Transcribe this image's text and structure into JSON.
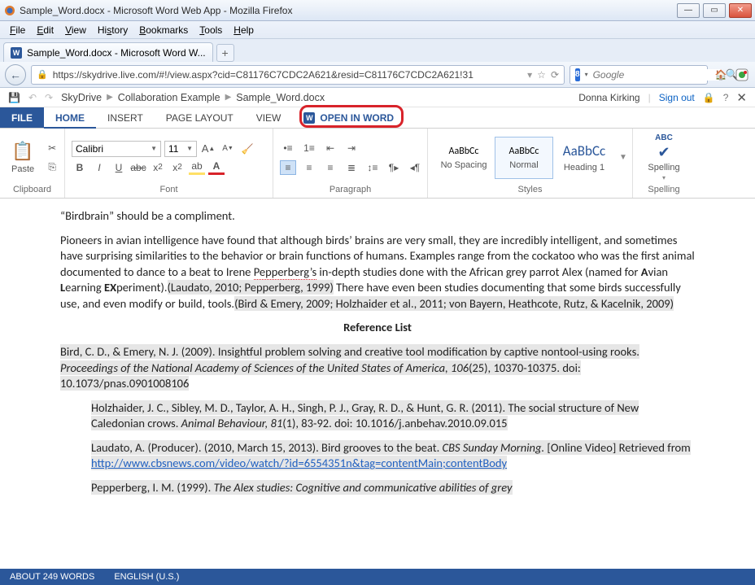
{
  "firefox": {
    "title": "Sample_Word.docx - Microsoft Word Web App - Mozilla Firefox",
    "menu": [
      "File",
      "Edit",
      "View",
      "History",
      "Bookmarks",
      "Tools",
      "Help"
    ],
    "tab_label": "Sample_Word.docx - Microsoft Word W...",
    "url": "https://skydrive.live.com/#!/view.aspx?cid=C81176C7CDC2A621&resid=C81176C7CDC2A621!31",
    "search_engine_badge": "8",
    "search_placeholder": "Google"
  },
  "wordbar": {
    "quick": {
      "save": "💾",
      "undo": "↶",
      "redo": "↷"
    },
    "breadcrumb": [
      "SkyDrive",
      "Collaboration Example",
      "Sample_Word.docx"
    ],
    "user": "Donna Kirking",
    "signout": "Sign out"
  },
  "tabs": {
    "file": "FILE",
    "home": "HOME",
    "insert": "INSERT",
    "page_layout": "PAGE LAYOUT",
    "view": "VIEW",
    "open_in_word": "OPEN IN WORD"
  },
  "ribbon": {
    "clipboard": {
      "label": "Clipboard",
      "paste": "Paste"
    },
    "font": {
      "label": "Font",
      "name": "Calibri",
      "size": "11"
    },
    "paragraph": {
      "label": "Paragraph"
    },
    "styles": {
      "label": "Styles",
      "items": [
        {
          "preview": "AaBbCc",
          "name": "No Spacing"
        },
        {
          "preview": "AaBbCc",
          "name": "Normal"
        },
        {
          "preview": "AaBbCc",
          "name": "Heading 1"
        }
      ]
    },
    "spelling": {
      "label": "Spelling",
      "button": "Spelling",
      "abc": "ABC"
    }
  },
  "document": {
    "line1": "“Birdbrain” should be a compliment.",
    "para2": {
      "pre": "Pioneers in avian intelligence have found that although birds’ brains are very small, they are incredibly intelligent, and sometimes have surprising similarities to the behavior or brain functions of humans.  Examples range from the cockatoo who was the first animal documented to dance to a beat to Irene ",
      "misspell": "Pepperberg’s",
      "mid": " in-depth studies done with the African grey parrot Alex (named for ",
      "avian_bold": "A",
      "avian_rest": "vian ",
      "learn_bold": "L",
      "learn_rest": "earning ",
      "ex_bold": "EX",
      "ex_rest": "periment).",
      "cite1": "(Laudato, 2010; Pepperberg, 1999)",
      "after1": "  There have even been studies documenting that some birds successfully use, and even modify or build, tools.",
      "cite2": "(Bird & Emery, 2009; Holzhaider et al., 2011; von Bayern, Heathcote, Rutz, & Kacelnik, 2009)"
    },
    "ref_heading": "Reference List",
    "refs": [
      {
        "a": "Bird, C. D., & Emery, N. J. (2009). Insightful problem solving and creative tool modification by captive nontool-using rooks. ",
        "i": "Proceedings of the National Academy of Sciences of the United States of America, 106",
        "b": "(25), 10370-10375. doi: 10.1073/pnas.0901008106"
      },
      {
        "a": "Holzhaider, J. C., Sibley, M. D., Taylor, A. H., Singh, P. J., Gray, R. D., & Hunt, G. R. (2011). The social structure of New Caledonian crows. ",
        "i": "Animal Behaviour, 81",
        "b": "(1), 83-92. doi: 10.1016/j.anbehav.2010.09.015"
      },
      {
        "a": "Laudato, A. (Producer). (2010, March 15, 2013). Bird grooves to the beat. ",
        "i": "CBS Sunday Morning. ",
        "b": "[Online Video] Retrieved from ",
        "link": "http://www.cbsnews.com/video/watch/?id=6554351n&tag=contentMain;contentBody"
      },
      {
        "a": "Pepperberg, I. M. (1999). ",
        "i": "The Alex studies: Cognitive and communicative abilities of grey"
      }
    ]
  },
  "status": {
    "words": "ABOUT 249 WORDS",
    "lang": "ENGLISH (U.S.)"
  }
}
